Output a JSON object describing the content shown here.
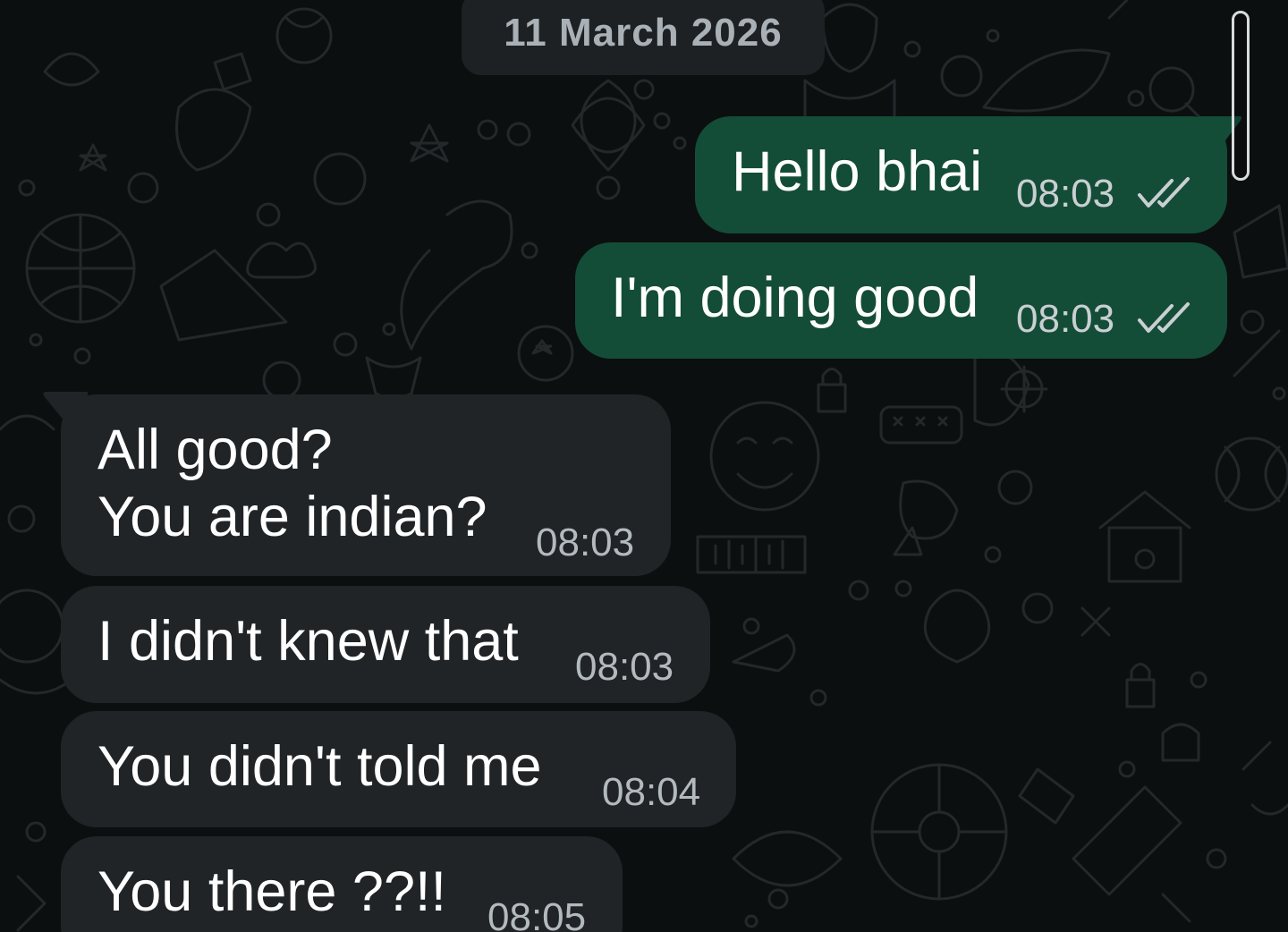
{
  "chat": {
    "date_separator": "11 March 2026",
    "messages": [
      {
        "direction": "outgoing",
        "text": "Hello bhai",
        "time": "08:03",
        "status_icon": "double-check-icon"
      },
      {
        "direction": "outgoing",
        "text": "I'm doing good",
        "time": "08:03",
        "status_icon": "double-check-icon"
      },
      {
        "direction": "incoming",
        "lines": [
          "All good?",
          "You are indian?"
        ],
        "time": "08:03"
      },
      {
        "direction": "incoming",
        "text": "I didn't knew that",
        "time": "08:03"
      },
      {
        "direction": "incoming",
        "text": "You didn't told me",
        "time": "08:04"
      },
      {
        "direction": "incoming",
        "text": "You there ??!!",
        "time": "08:05"
      }
    ]
  },
  "colors": {
    "background": "#0c0f10",
    "outgoing_bubble": "#144d37",
    "incoming_bubble": "#202427",
    "date_chip": "#1d2124",
    "text": "#ffffff"
  }
}
